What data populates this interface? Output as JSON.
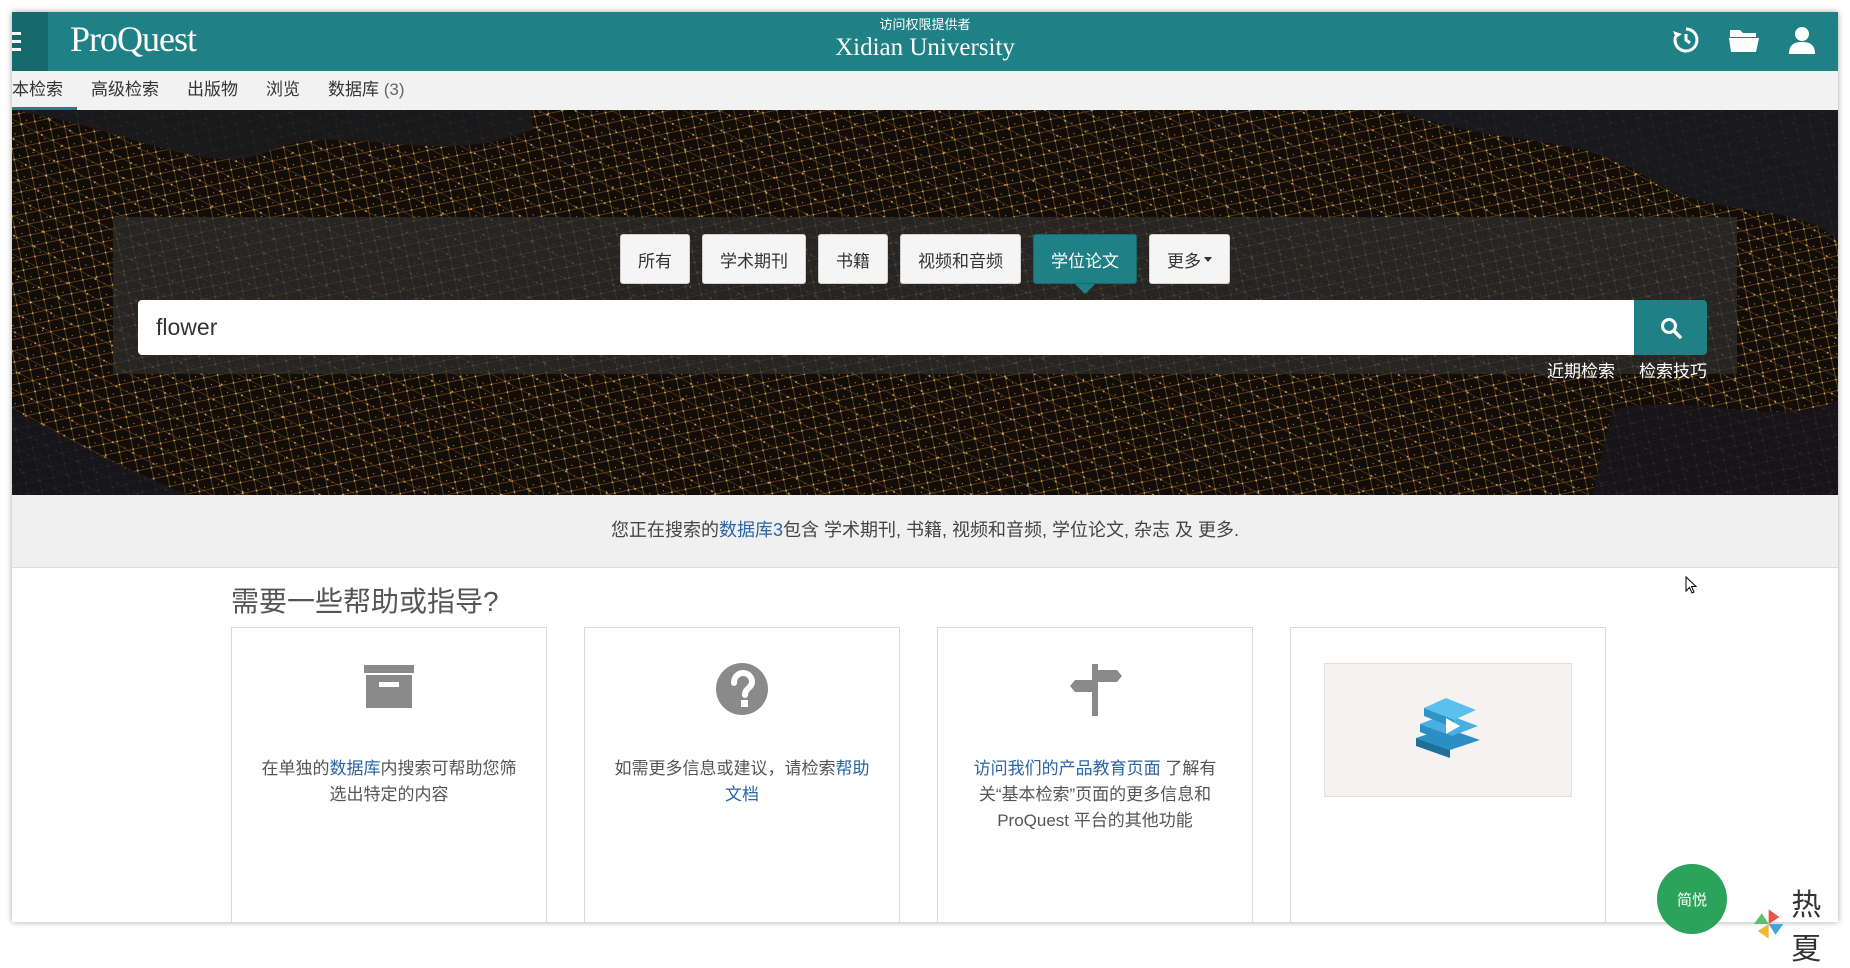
{
  "header": {
    "logo": "ProQuest",
    "access_label": "访问权限提供者",
    "institution": "Xidian University",
    "icons": [
      "menu-icon",
      "history-icon",
      "folder-icon",
      "user-icon"
    ]
  },
  "nav": {
    "tabs": [
      {
        "label": "本检索",
        "active": true
      },
      {
        "label": "高级检索"
      },
      {
        "label": "出版物"
      },
      {
        "label": "浏览"
      },
      {
        "label": "数据库"
      }
    ],
    "db_count": "(3)"
  },
  "search": {
    "chips": [
      {
        "label": "所有"
      },
      {
        "label": "学术期刊"
      },
      {
        "label": "书籍"
      },
      {
        "label": "视频和音频"
      },
      {
        "label": "学位论文",
        "active": true
      },
      {
        "label": "更多"
      }
    ],
    "query": "flower",
    "links": {
      "recent": "近期检索",
      "tips": "检索技巧"
    }
  },
  "info": {
    "prefix": "您正在搜索的",
    "db_link": "数据库3",
    "suffix": "包含 学术期刊, 书籍, 视频和音频, 学位论文, 杂志 及 更多."
  },
  "help": {
    "title": "需要一些帮助或指导?",
    "cards": [
      {
        "icon": "archive-box-icon",
        "text_before": "在单独的",
        "link": "数据库",
        "text_after": "内搜索可帮助您筛选出特定的内容"
      },
      {
        "icon": "question-circle-icon",
        "text_before": "如需更多信息或建议，请检索",
        "link": "帮助文档",
        "text_after": ""
      },
      {
        "icon": "signpost-icon",
        "text_before": "",
        "link": "访问我们的产品教育页面",
        "text_after": " 了解有关“基本检索”页面的更多信息和 ProQuest 平台的其他功能"
      },
      {
        "icon": "video-thumbnail-books-icon"
      }
    ]
  },
  "floating": {
    "feedback_label": "简悦",
    "watermark": "热夏"
  },
  "colors": {
    "brand": "#1f8185",
    "link": "#2a64a4",
    "feedback": "#2ca35b"
  }
}
